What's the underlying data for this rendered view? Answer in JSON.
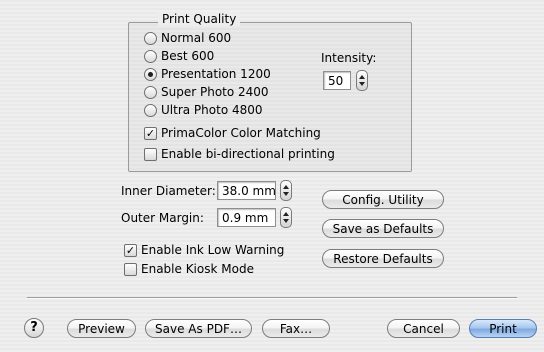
{
  "print_quality": {
    "title": "Print Quality",
    "options": [
      {
        "label": "Normal 600",
        "selected": false
      },
      {
        "label": "Best 600",
        "selected": false
      },
      {
        "label": "Presentation 1200",
        "selected": true
      },
      {
        "label": "Super Photo 2400",
        "selected": false
      },
      {
        "label": "Ultra Photo 4800",
        "selected": false
      }
    ],
    "intensity_label": "Intensity:",
    "intensity_value": "50",
    "primacolor_label": "PrimaColor Color Matching",
    "primacolor_checked": true,
    "bidirectional_label": "Enable bi-directional printing",
    "bidirectional_checked": false
  },
  "settings": {
    "inner_diameter_label": "Inner Diameter:",
    "inner_diameter_value": "38.0 mm",
    "outer_margin_label": "Outer Margin:",
    "outer_margin_value": "0.9 mm",
    "ink_low_label": "Enable Ink Low Warning",
    "ink_low_checked": true,
    "kiosk_label": "Enable Kiosk Mode",
    "kiosk_checked": false
  },
  "side_buttons": {
    "config_utility": "Config. Utility",
    "save_defaults": "Save as Defaults",
    "restore_defaults": "Restore Defaults"
  },
  "footer": {
    "help": "?",
    "preview": "Preview",
    "save_pdf": "Save As PDF…",
    "fax": "Fax…",
    "cancel": "Cancel",
    "print": "Print"
  },
  "colors": {
    "default_button": "#8fb4e6"
  }
}
